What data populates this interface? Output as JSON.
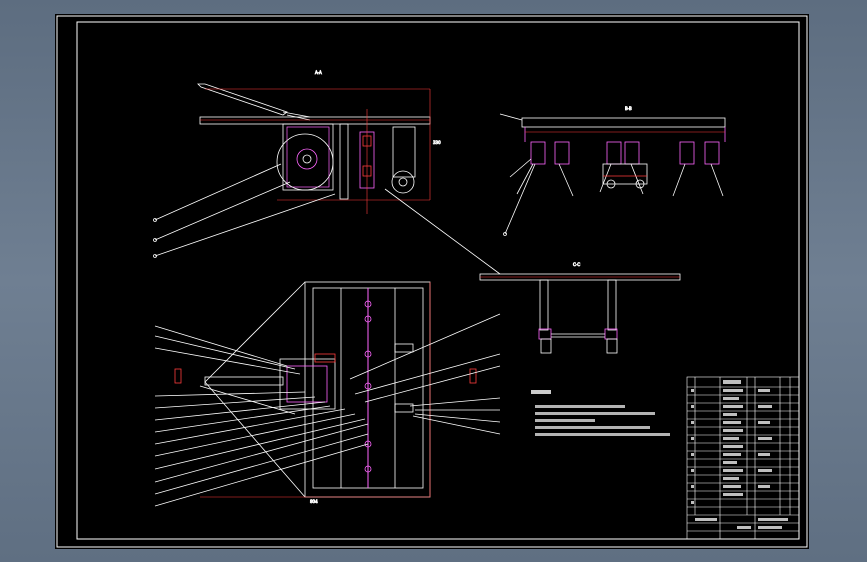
{
  "drawing": {
    "background": "#000000",
    "line_color": "#ffffff",
    "accent_color": "#ff3b3b",
    "highlight_color": "#ff66ff",
    "section_titles": {
      "side_view": "A-A",
      "front_view": "B-B",
      "bottom_detail": "C-C"
    },
    "dimension_labels": {
      "top_width": "804",
      "right_height": "330",
      "plan_width": "804"
    }
  }
}
